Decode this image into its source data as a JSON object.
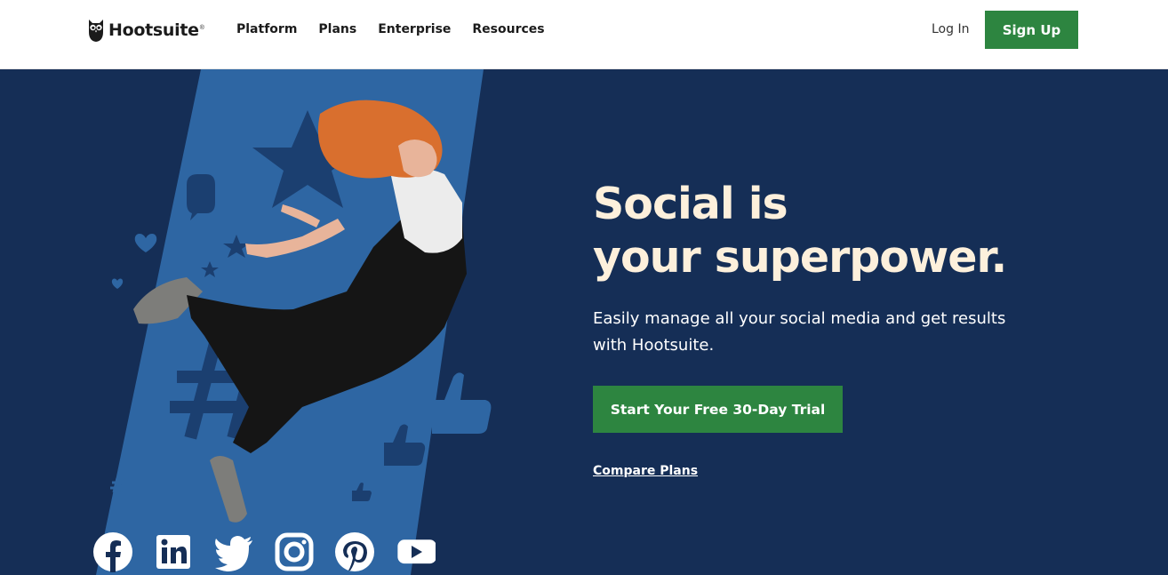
{
  "brand": {
    "name": "Hootsuite",
    "mark": "®",
    "accent": "#2d8540",
    "hero_bg": "#152e56",
    "headline_color": "#fdf0dc"
  },
  "nav": {
    "items": [
      "Platform",
      "Plans",
      "Enterprise",
      "Resources"
    ]
  },
  "header": {
    "login_label": "Log In",
    "signup_label": "Sign Up"
  },
  "hero": {
    "headline_line1": "Social is",
    "headline_line2": "your superpower.",
    "subtext": "Easily manage all your social media and get results with Hootsuite.",
    "cta_label": "Start Your Free 30-Day Trial",
    "compare_label": "Compare Plans"
  },
  "socials": [
    {
      "icon": "facebook-icon"
    },
    {
      "icon": "linkedin-icon"
    },
    {
      "icon": "twitter-icon"
    },
    {
      "icon": "instagram-icon"
    },
    {
      "icon": "pinterest-icon"
    },
    {
      "icon": "youtube-icon"
    }
  ]
}
